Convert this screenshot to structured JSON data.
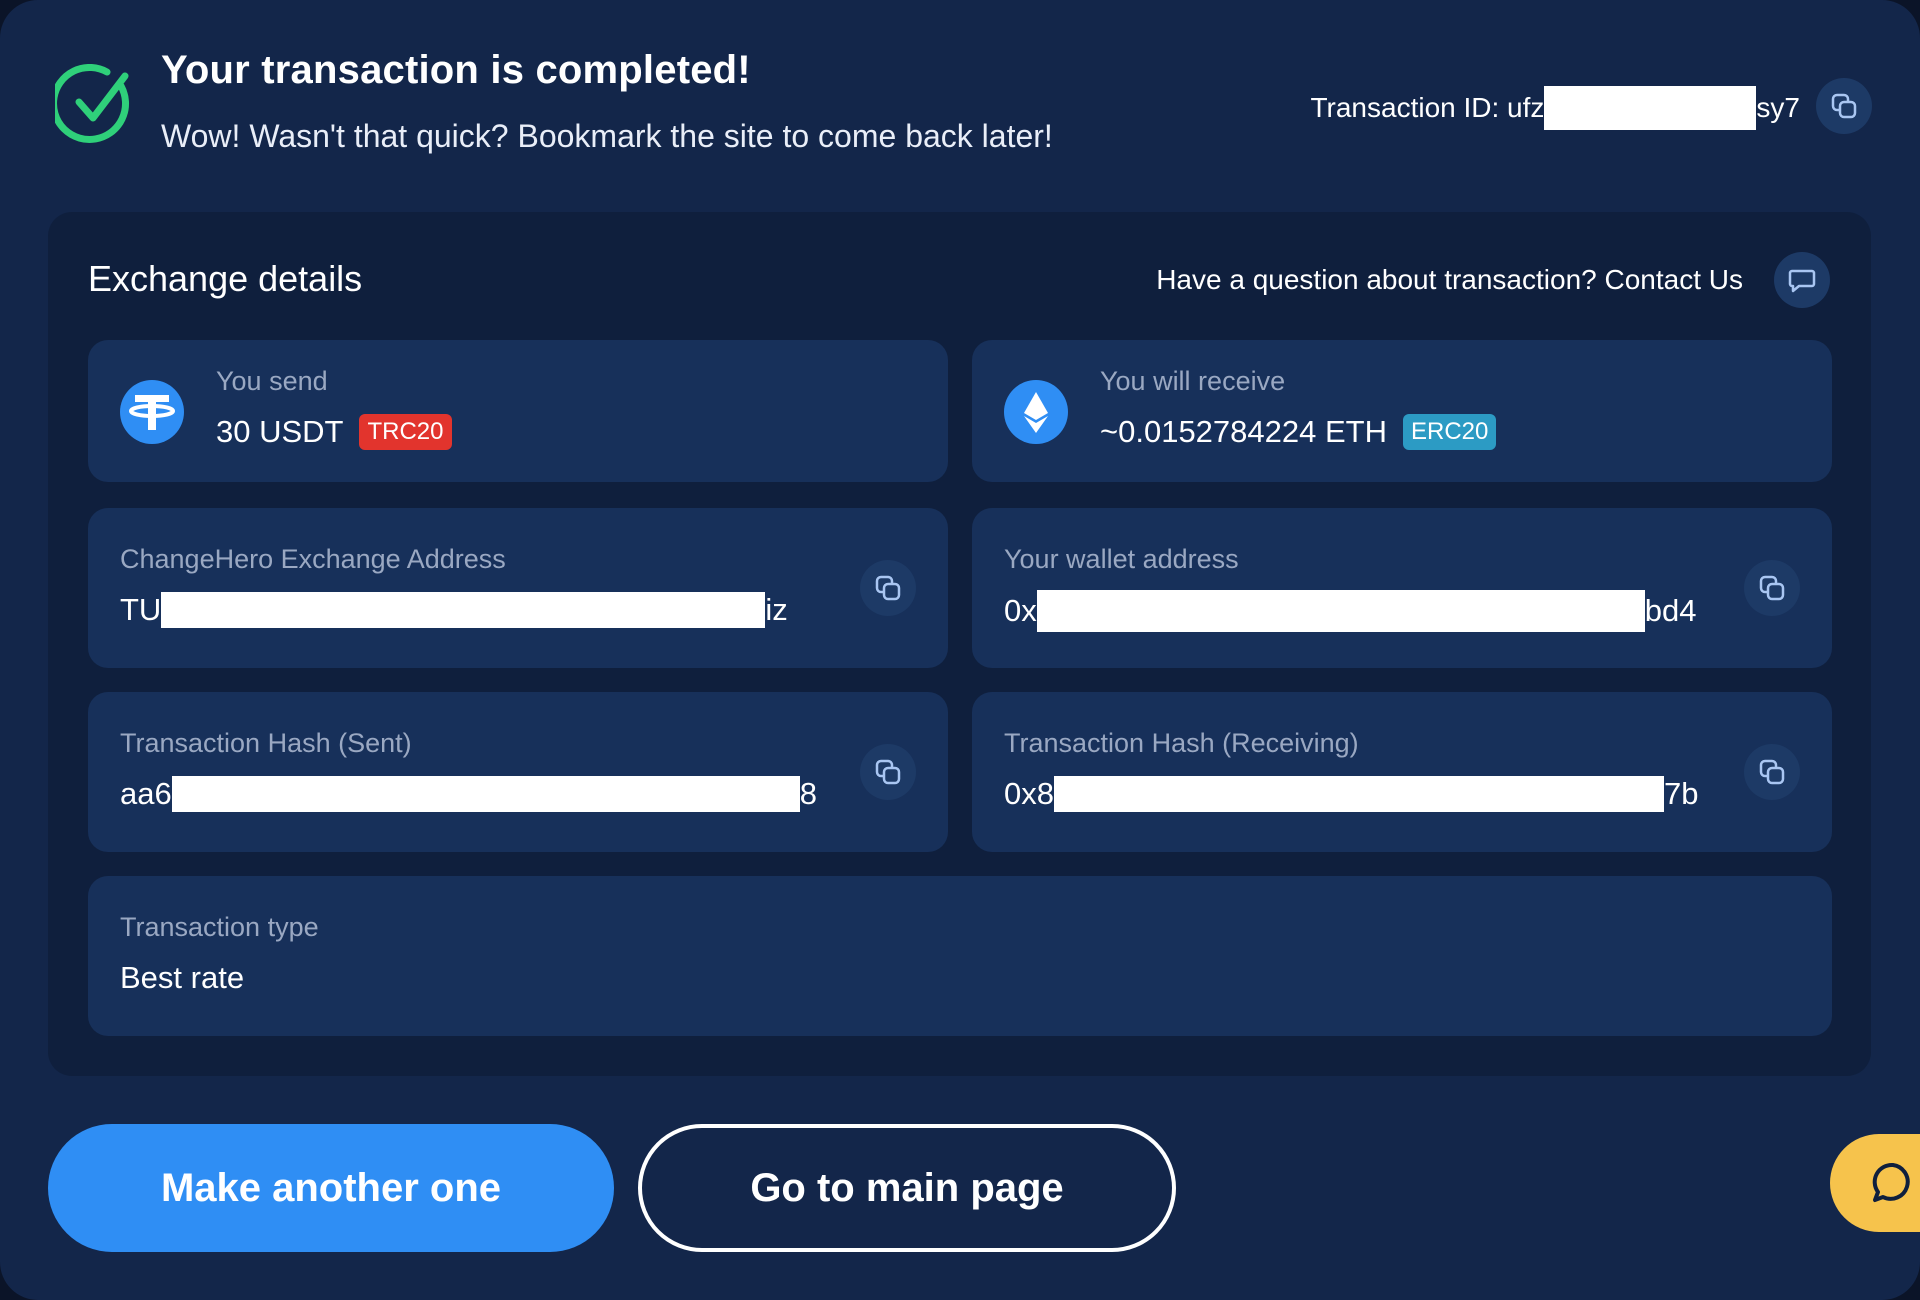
{
  "header": {
    "title": "Your transaction is completed!",
    "subtitle": "Wow! Wasn't that quick? Bookmark the site to come back later!",
    "txid_prefix": "Transaction ID: ufz",
    "txid_suffix": "sy7",
    "status_icon": "check-circle-icon",
    "copy_icon": "copy-icon"
  },
  "details": {
    "title": "Exchange details",
    "contact_text": "Have a question about transaction? Contact Us",
    "contact_icon": "chat-bubble-icon",
    "send": {
      "label": "You send",
      "amount": "30 USDT",
      "network": "TRC20",
      "coin_icon": "tether-icon"
    },
    "receive": {
      "label": "You will receive",
      "amount": "~0.0152784224 ETH",
      "network": "ERC20",
      "coin_icon": "ethereum-icon"
    },
    "exchange_address": {
      "label": "ChangeHero Exchange Address",
      "prefix": "TU",
      "suffix": "iz"
    },
    "wallet_address": {
      "label": "Your wallet address",
      "prefix": "0x",
      "suffix": "bd4"
    },
    "hash_sent": {
      "label": "Transaction Hash (Sent)",
      "prefix": "aa6",
      "suffix": "8"
    },
    "hash_receiving": {
      "label": "Transaction Hash (Receiving)",
      "prefix": "0x8",
      "suffix": "7b"
    },
    "transaction_type": {
      "label": "Transaction type",
      "value": "Best rate"
    }
  },
  "actions": {
    "primary_label": "Make another one",
    "secondary_label": "Go to main page",
    "chat_icon": "chat-icon"
  },
  "colors": {
    "background": "#13264a",
    "panel": "#0f1f3d",
    "card": "#17305a",
    "accent_blue": "#2f8ef4",
    "success_green": "#2fd07a",
    "trc_badge": "#e2342d",
    "erc_badge": "#2c9bc4",
    "chat_yellow": "#f6c34c"
  }
}
